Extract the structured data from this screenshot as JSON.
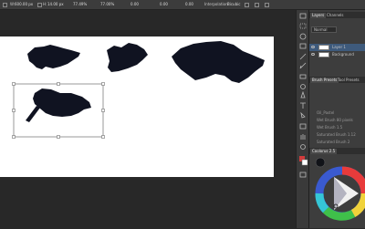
{
  "options": {
    "size_value": "600.00 px",
    "angle_value": "14.00 px",
    "x_value": "77.49%",
    "y_value": "77.00%",
    "angle2_value": "0.00",
    "h_value": "0.00",
    "v_value": "0.00",
    "interp_label": "Interpolation:",
    "interp_value": "Bicubic"
  },
  "panels": {
    "layers_tab": "Layers",
    "channels_tab": "Channels",
    "blend_mode": "Normal",
    "layer_items": [
      {
        "name": "Layer 1"
      },
      {
        "name": "Background"
      }
    ],
    "brush_presets_tab": "Brush Presets",
    "tool_presets_tab": "Tool Presets",
    "preset_items": [
      "Oil_Pastel",
      "Wet Brush 80 pixels",
      "Wet Brush 1.5",
      "Saturated Brush 1.12",
      "Saturated Brush 2"
    ],
    "coolorus_tab": "Coolorus 2.5"
  },
  "colors": {
    "app_bg": "#282828",
    "panel_bg": "#3d3d3d",
    "canvas": "#ffffff",
    "ink": "#101321",
    "selected_layer": "#3e5a7c"
  },
  "icons": [
    "move-tool-icon",
    "marquee-tool-icon",
    "lasso-tool-icon",
    "crop-tool-icon",
    "eyedropper-tool-icon",
    "brush-tool-icon",
    "eraser-tool-icon",
    "type-tool-icon",
    "hand-tool-icon",
    "zoom-tool-icon",
    "eye-icon",
    "color-wheel-icon"
  ]
}
